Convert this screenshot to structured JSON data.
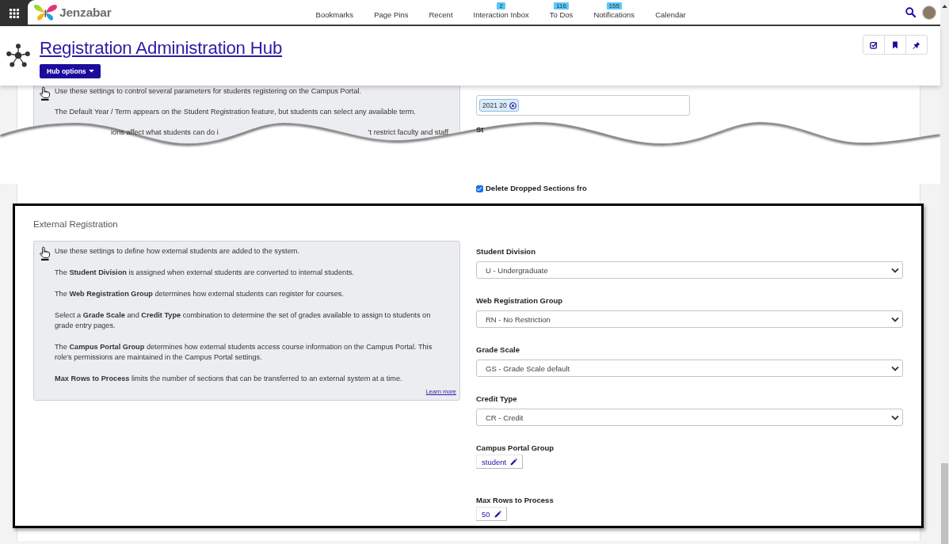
{
  "nav": {
    "logo_text": "Jenzabar",
    "items": [
      {
        "label": "Bookmarks"
      },
      {
        "label": "Page Pins"
      },
      {
        "label": "Recent"
      },
      {
        "label": "Interaction Inbox",
        "badge": "2"
      },
      {
        "label": "To Dos",
        "badge": "116"
      },
      {
        "label": "Notifications",
        "badge": "155"
      },
      {
        "label": "Calendar"
      }
    ]
  },
  "header": {
    "title": "Registration Administration Hub",
    "options_button": "Hub options"
  },
  "upper_section": {
    "info_lines": [
      "Use these settings to control several parameters for students registering on the Campus Portal.",
      "The Default Year / Term appears on the Student Registration feature, but students can select any available term."
    ],
    "info_fragments": [
      "ions affect what students can do i",
      "'t restrict faculty and staff"
    ],
    "term_chips": [
      "2021 20"
    ],
    "field_label_fragment": "St",
    "checkbox": {
      "label": "Delete Dropped Sections fro",
      "checked": true
    }
  },
  "external_registration": {
    "title": "External Registration",
    "info_paragraphs": [
      "Use these settings to define how external students are added to the system.",
      "The **Student Division** is assigned when external students are converted to internal students.",
      "The **Web Registration Group** determines how external students can register for courses.",
      "Select a **Grade Scale** and **Credit Type** combination to determine the set of grades available to assign to students on grade entry pages.",
      "The **Campus Portal Group** determines how external students access course information on the Campus Portal. This role's permissions are maintained in the Campus Portal settings.",
      "**Max Rows to Process** limits the number of sections that can be transferred to an external system at a time."
    ],
    "learn_more": "Learn more",
    "fields": [
      {
        "kind": "select",
        "label": "Student Division",
        "value": "U - Undergraduate"
      },
      {
        "kind": "select",
        "label": "Web Registration Group",
        "value": "RN - No Restriction"
      },
      {
        "kind": "select",
        "label": "Grade Scale",
        "value": "GS - Grade Scale default"
      },
      {
        "kind": "select",
        "label": "Credit Type",
        "value": "CR - Credit"
      },
      {
        "kind": "edit",
        "label": "Campus Portal Group",
        "value": "student"
      },
      {
        "kind": "edit",
        "label": "Max Rows to Process",
        "value": "50"
      }
    ]
  }
}
